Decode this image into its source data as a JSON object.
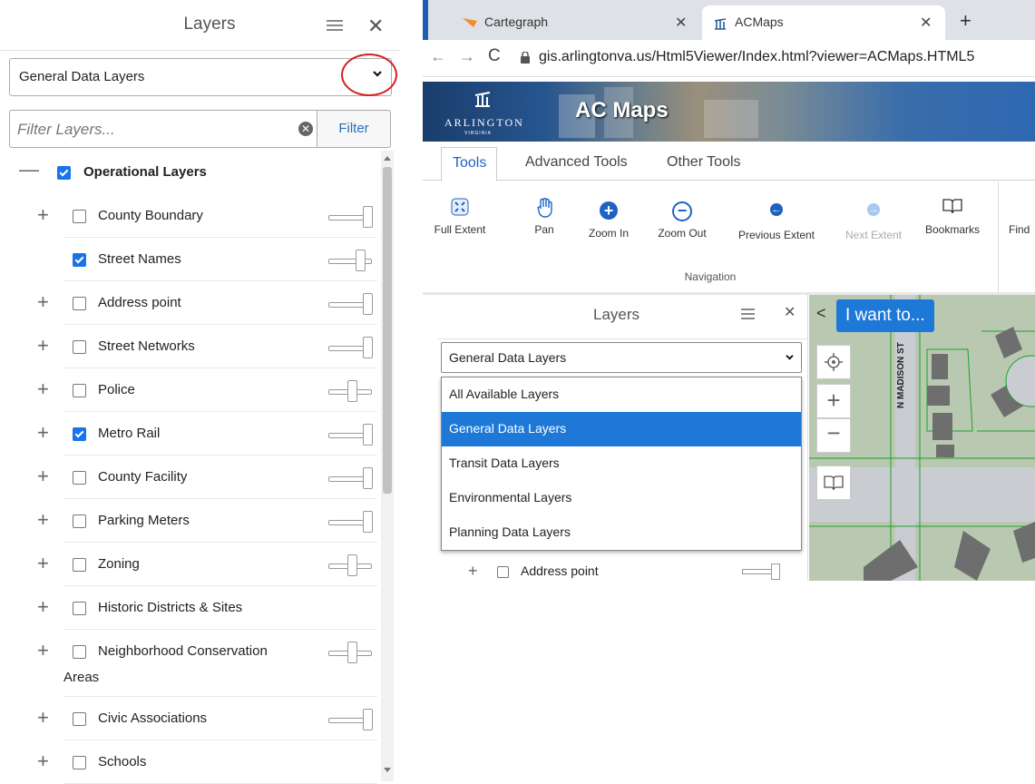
{
  "left_panel": {
    "title": "Layers",
    "layer_set": "General Data Layers",
    "filter_placeholder": "Filter Layers...",
    "filter_button": "Filter",
    "group": {
      "label": "Operational Layers",
      "checked": true
    },
    "layers": [
      {
        "label": "County Boundary",
        "checked": false,
        "expandable": true,
        "opacity_pct": 100
      },
      {
        "label": "Street Names",
        "checked": true,
        "expandable": false,
        "opacity_pct": 80
      },
      {
        "label": "Address point",
        "checked": false,
        "expandable": true,
        "opacity_pct": 100
      },
      {
        "label": "Street Networks",
        "checked": false,
        "expandable": true,
        "opacity_pct": 100
      },
      {
        "label": "Police",
        "checked": false,
        "expandable": true,
        "opacity_pct": 55
      },
      {
        "label": "Metro Rail",
        "checked": true,
        "expandable": true,
        "opacity_pct": 100
      },
      {
        "label": "County Facility",
        "checked": false,
        "expandable": true,
        "opacity_pct": 100
      },
      {
        "label": "Parking Meters",
        "checked": false,
        "expandable": true,
        "opacity_pct": 100
      },
      {
        "label": "Zoning",
        "checked": false,
        "expandable": true,
        "opacity_pct": 55
      },
      {
        "label": "Historic Districts & Sites",
        "checked": false,
        "expandable": true,
        "opacity_pct": null
      },
      {
        "label": "Neighborhood Conservation",
        "label_cont": "Areas",
        "checked": false,
        "expandable": true,
        "opacity_pct": 55
      },
      {
        "label": "Civic Associations",
        "checked": false,
        "expandable": true,
        "opacity_pct": 100
      },
      {
        "label": "Schools",
        "checked": false,
        "expandable": true,
        "opacity_pct": null
      }
    ]
  },
  "browser": {
    "tabs": [
      {
        "title": "Cartegraph",
        "active": false
      },
      {
        "title": "ACMaps",
        "active": true
      }
    ],
    "url": "gis.arlingtonva.us/Html5Viewer/Index.html?viewer=ACMaps.HTML5",
    "banner": {
      "org": "ARLINGTON",
      "org_sub": "VIRGINIA",
      "app_title": "AC Maps"
    },
    "tool_tabs": [
      "Tools",
      "Advanced Tools",
      "Other Tools"
    ],
    "tools": [
      {
        "label": "Full Extent",
        "icon": "full-extent-icon"
      },
      {
        "label": "Pan",
        "icon": "hand-icon"
      },
      {
        "label": "Zoom In",
        "icon": "plus-circle-icon"
      },
      {
        "label": "Zoom Out",
        "icon": "minus-circle-icon"
      },
      {
        "label": "Previous Extent",
        "icon": "left-arrow-circle-icon"
      },
      {
        "label": "Next Extent",
        "icon": "right-arrow-circle-icon",
        "disabled": true
      },
      {
        "label": "Bookmarks",
        "icon": "book-icon"
      },
      {
        "label": "Find"
      }
    ],
    "tool_group_label": "Navigation",
    "inner_panel": {
      "title": "Layers",
      "layer_set": "General Data Layers",
      "options": [
        "All Available Layers",
        "General Data Layers",
        "Transit Data Layers",
        "Environmental Layers",
        "Planning Data Layers"
      ],
      "selected_option": "General Data Layers",
      "peek_row": "Address point"
    },
    "map": {
      "i_want_to": "I want to...",
      "street_label": "N MADISON ST"
    }
  },
  "colors": {
    "accent": "#1e78d7",
    "annotation": "#d61f1f",
    "checkbox": "#1a73e8"
  }
}
